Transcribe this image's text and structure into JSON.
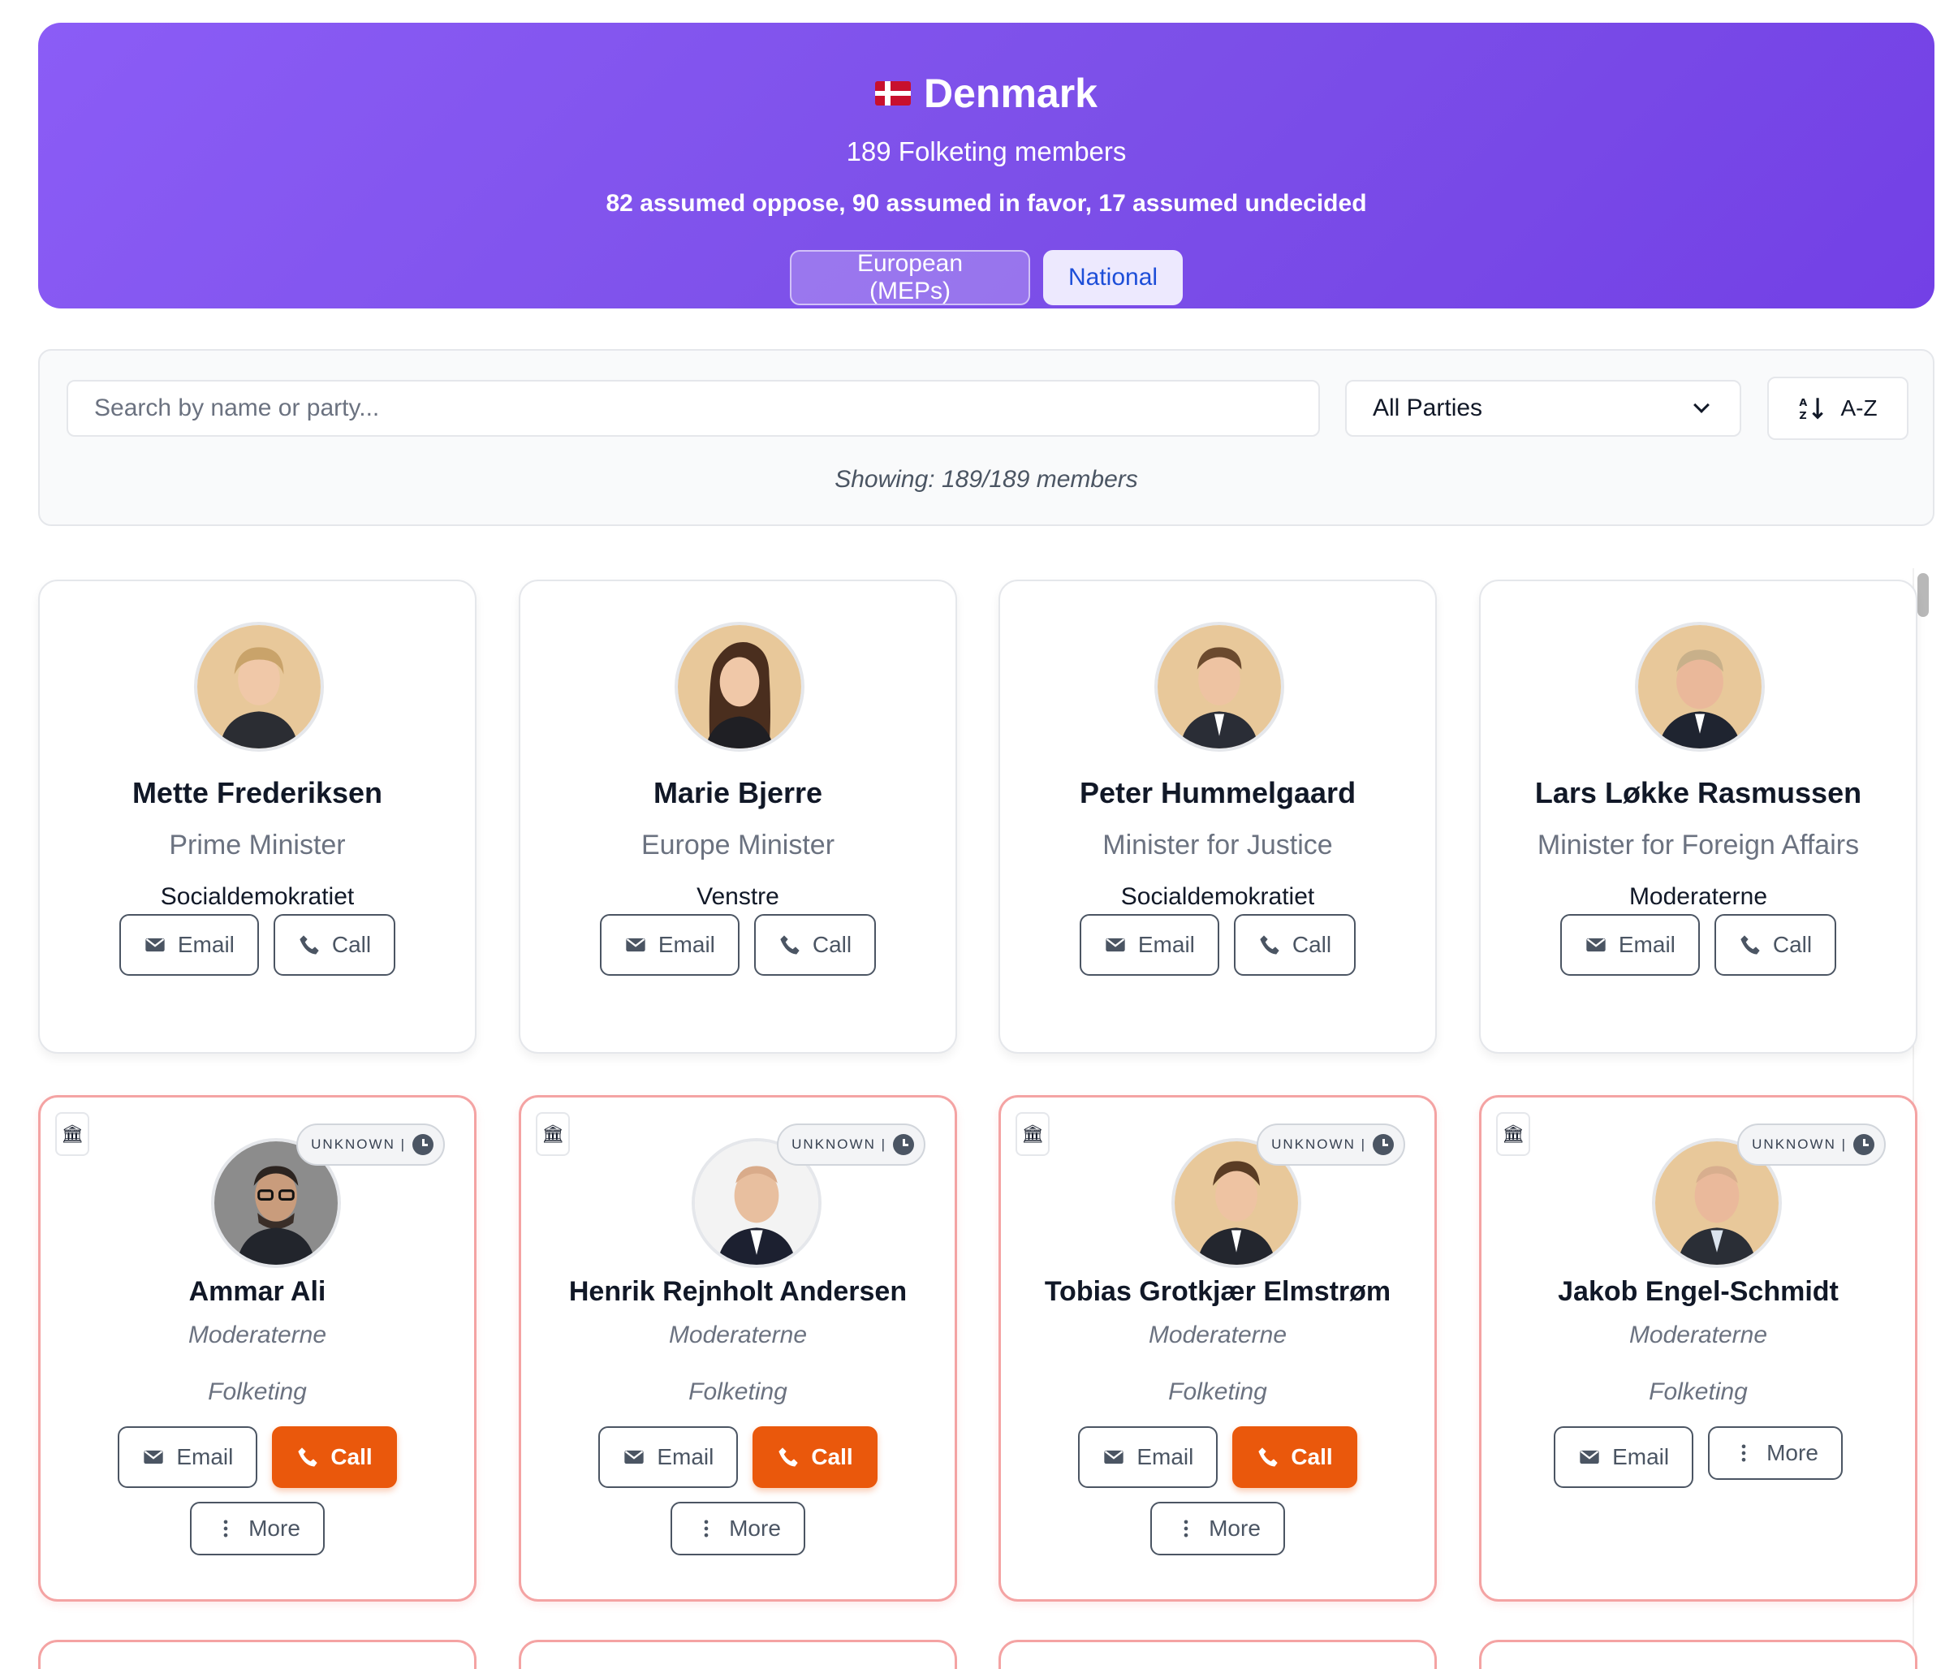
{
  "header": {
    "country": "Denmark",
    "subtitle": "189 Folketing members",
    "counts": "82 assumed oppose, 90 assumed in favor, 17 assumed undecided",
    "toggle": {
      "european": "European (MEPs)",
      "national": "National",
      "active": "National"
    }
  },
  "filters": {
    "search_placeholder": "Search by name or party...",
    "party_select": "All Parties",
    "sort_label": "A-Z",
    "showing": "Showing: 189/189 members"
  },
  "colors": {
    "accent": "#7c4fe8",
    "call_active": "#ea580c",
    "pending_border": "#f4a3a3"
  },
  "ministers": [
    {
      "name": "Mette Frederiksen",
      "role": "Prime Minister",
      "party": "Socialdemokratiet",
      "email": "Email",
      "call": "Call"
    },
    {
      "name": "Marie Bjerre",
      "role": "Europe Minister",
      "party": "Venstre",
      "email": "Email",
      "call": "Call"
    },
    {
      "name": "Peter Hummelgaard",
      "role": "Minister for Justice",
      "party": "Socialdemokratiet",
      "email": "Email",
      "call": "Call"
    },
    {
      "name": "Lars Løkke Rasmussen",
      "role": "Minister for Foreign Affairs",
      "party": "Moderaterne",
      "email": "Email",
      "call": "Call"
    }
  ],
  "members": [
    {
      "name": "Ammar Ali",
      "party": "Moderaterne",
      "body": "Folketing",
      "status": "UNKNOWN |",
      "email": "Email",
      "call": "Call",
      "more": "More"
    },
    {
      "name": "Henrik Rejnholt Andersen",
      "party": "Moderaterne",
      "body": "Folketing",
      "status": "UNKNOWN |",
      "email": "Email",
      "call": "Call",
      "more": "More"
    },
    {
      "name": "Tobias Grotkjær Elmstrøm",
      "party": "Moderaterne",
      "body": "Folketing",
      "status": "UNKNOWN |",
      "email": "Email",
      "call": "Call",
      "more": "More"
    },
    {
      "name": "Jakob Engel-Schmidt",
      "party": "Moderaterne",
      "body": "Folketing",
      "status": "UNKNOWN |",
      "email": "Email",
      "more": "More"
    }
  ]
}
